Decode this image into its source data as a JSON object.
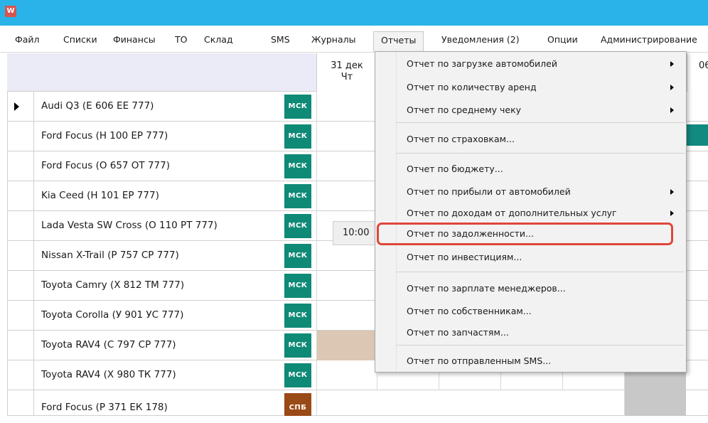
{
  "app_icon": "W",
  "menu": {
    "items": [
      "Файл",
      "Списки",
      "Финансы",
      "ТО",
      "Склад",
      "SMS",
      "Журналы",
      "Отчеты",
      "Уведомления (2)",
      "Опции",
      "Администрирование"
    ]
  },
  "header": {
    "date_day": "31 дек",
    "date_weekday": "Чт",
    "date_next": "06"
  },
  "rows": [
    {
      "name": "Audi Q3 (Е 606 ЕЕ 777)",
      "region": "МСК"
    },
    {
      "name": "Ford Focus (Н 100 ЕР 777)",
      "region": "МСК"
    },
    {
      "name": "Ford Focus (О 657 ОТ 777)",
      "region": "МСК"
    },
    {
      "name": "Kia Ceed (Н 101 ЕР 777)",
      "region": "МСК"
    },
    {
      "name": "Lada Vesta SW Cross (О 110 РТ 777)",
      "region": "МСК"
    },
    {
      "name": "Nissan X-Trail (Р 757 СР 777)",
      "region": "МСК"
    },
    {
      "name": "Toyota Camry (Х 812 ТМ 777)",
      "region": "МСК"
    },
    {
      "name": "Toyota Corolla (У 901 УС 777)",
      "region": "МСК"
    },
    {
      "name": "Toyota RAV4 (С 797 СР 777)",
      "region": "МСК"
    },
    {
      "name": "Toyota RAV4 (Х 980 ТК 777)",
      "region": "МСК"
    },
    {
      "name": "Ford Focus (Р 371 ЕК 178)",
      "region": "СПБ"
    }
  ],
  "time_tag": "10:00",
  "dropdown": {
    "items": [
      {
        "label": "Отчет по загрузке автомобилей",
        "submenu": true
      },
      {
        "label": "Отчет по количеству аренд",
        "submenu": true
      },
      {
        "label": "Отчет по среднему чеку",
        "submenu": true
      },
      {
        "label": "Отчет по страховкам...",
        "submenu": false
      },
      {
        "label": "Отчет по бюджету...",
        "submenu": false
      },
      {
        "label": "Отчет по прибыли от автомобилей",
        "submenu": true
      },
      {
        "label": "Отчет по доходам от дополнительных услуг",
        "submenu": true
      },
      {
        "label": "Отчет по задолженности...",
        "submenu": false
      },
      {
        "label": "Отчет по инвестициям...",
        "submenu": false
      },
      {
        "label": "Отчет по зарплате менеджеров...",
        "submenu": false
      },
      {
        "label": "Отчет по собственникам...",
        "submenu": false
      },
      {
        "label": "Отчет по запчастям...",
        "submenu": false
      },
      {
        "label": "Отчет по отправленным SMS...",
        "submenu": false
      }
    ]
  },
  "colors": {
    "titlebar": "#29b3e8",
    "region_msk": "#0f8a76",
    "region_spb": "#9a4a16",
    "highlight": "#e0463a",
    "booking_teal": "#138a80",
    "booking_tan": "#dcc7b5",
    "booking_gray": "#c8c8c8"
  }
}
